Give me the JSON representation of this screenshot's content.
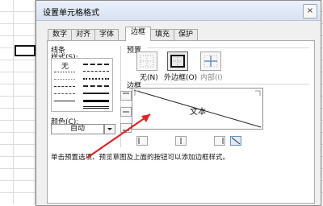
{
  "dialog": {
    "title": "设置单元格格式",
    "close_glyph": "×"
  },
  "tabs": [
    "数字",
    "对齐",
    "字体",
    "边框",
    "填充",
    "保护"
  ],
  "active_tab": "边框",
  "line_section": {
    "label": "线条",
    "style_label": "样式(S):",
    "none_label": "无",
    "color_label": "颜色(C):",
    "color_value": "自动"
  },
  "preset_section": {
    "label": "预置",
    "none": "无(N)",
    "outline": "外边框(O)",
    "inside": "内部(I)"
  },
  "border_section": {
    "label": "边框",
    "preview_text": "文本"
  },
  "hint": "单击预置选项、预览草图及上面的按钮可以添加边框样式。",
  "colors": {
    "accent_arrow": "#e02424",
    "titlebar": "#dbe5f4"
  }
}
